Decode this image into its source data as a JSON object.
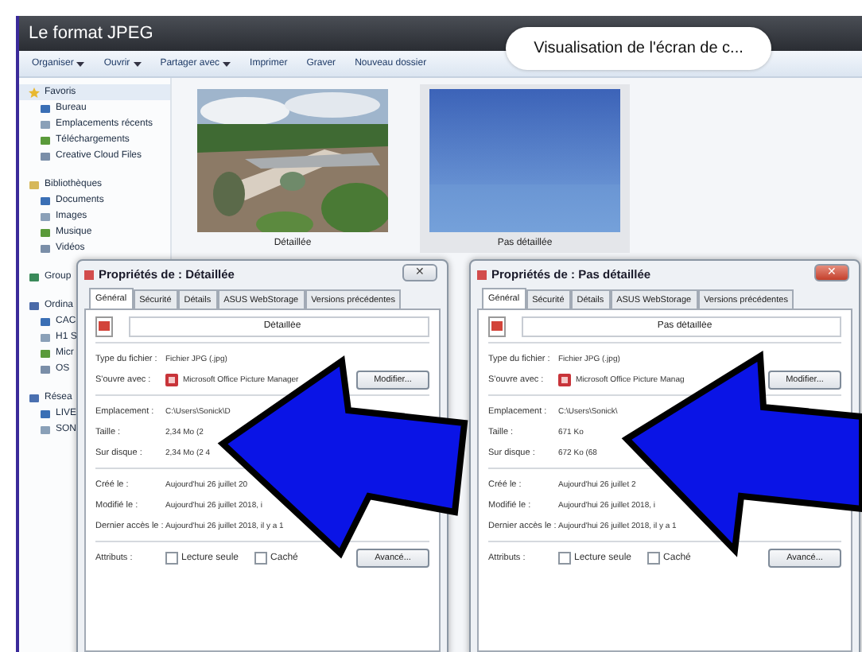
{
  "window": {
    "title": "Le format JPEG"
  },
  "caption": "Visualisation de l'écran de c...",
  "toolbar": [
    {
      "label": "Organiser",
      "dropdown": true
    },
    {
      "label": "Ouvrir",
      "dropdown": true
    },
    {
      "label": "Partager avec",
      "dropdown": true
    },
    {
      "label": "Imprimer",
      "dropdown": false
    },
    {
      "label": "Graver",
      "dropdown": false
    },
    {
      "label": "Nouveau dossier",
      "dropdown": false
    }
  ],
  "sidebar": [
    {
      "label": "Favoris",
      "selected": true,
      "children": [
        {
          "label": "Bureau"
        },
        {
          "label": "Emplacements récents"
        },
        {
          "label": "Téléchargements"
        },
        {
          "label": "Creative Cloud Files"
        }
      ]
    },
    {
      "label": "Bibliothèques",
      "selected": false,
      "children": [
        {
          "label": "Documents"
        },
        {
          "label": "Images"
        },
        {
          "label": "Musique"
        },
        {
          "label": "Vidéos"
        }
      ]
    },
    {
      "label": "Group",
      "selected": false
    },
    {
      "label": "Ordina",
      "selected": false,
      "children": [
        {
          "label": "CAC"
        },
        {
          "label": "H1 S"
        },
        {
          "label": "Micr"
        },
        {
          "label": "OS"
        }
      ]
    },
    {
      "label": "Résea",
      "selected": false,
      "children": [
        {
          "label": "LIVE"
        },
        {
          "label": "SON"
        }
      ]
    }
  ],
  "files": [
    {
      "name": "Détaillée",
      "selected": false
    },
    {
      "name": "Pas détaillée",
      "selected": true,
      "kind": "sky"
    }
  ],
  "dialogs": [
    {
      "title": "Propriétés de : Détaillée",
      "close_label": "✕",
      "close_highlighted": false,
      "tabs": [
        {
          "label": "Général",
          "selected": true
        },
        {
          "label": "Sécurité",
          "selected": false
        },
        {
          "label": "Détails",
          "selected": false
        },
        {
          "label": "ASUS WebStorage",
          "selected": false
        },
        {
          "label": "Versions précédentes",
          "selected": false
        }
      ],
      "name": "Détaillée",
      "sections": [
        [
          {
            "label": "Type du fichier :",
            "value": "Fichier JPG (.jpg)"
          },
          {
            "label": "S'ouvre avec :",
            "value": "Microsoft Office Picture Manager",
            "button": "Modifier..."
          }
        ],
        [
          {
            "label": "Emplacement :",
            "value": "C:\\Users\\Sonick\\D"
          },
          {
            "label": "Taille :",
            "value": "2,34 Mo (2"
          },
          {
            "label": "Sur disque :",
            "value": "2,34 Mo (2 4"
          }
        ],
        [
          {
            "label": "Créé le :",
            "value": "Aujourd'hui 26 juillet 20"
          },
          {
            "label": "Modifié le :",
            "value": "Aujourd'hui 26 juillet 2018, i"
          },
          {
            "label": "Dernier accès le :",
            "value": "Aujourd'hui 26 juillet 2018, il y a 1"
          }
        ]
      ],
      "attributes_label": "Attributs :",
      "attributes": [
        {
          "label": "Lecture seule",
          "checked": false
        },
        {
          "label": "Caché",
          "checked": false
        }
      ],
      "advanced_button": "Avancé..."
    },
    {
      "title": "Propriétés de : Pas détaillée",
      "close_label": "✕",
      "close_highlighted": true,
      "tabs": [
        {
          "label": "Général",
          "selected": true
        },
        {
          "label": "Sécurité",
          "selected": false
        },
        {
          "label": "Détails",
          "selected": false
        },
        {
          "label": "ASUS WebStorage",
          "selected": false
        },
        {
          "label": "Versions précédentes",
          "selected": false
        }
      ],
      "name": "Pas détaillée",
      "sections": [
        [
          {
            "label": "Type du fichier :",
            "value": "Fichier JPG (.jpg)"
          },
          {
            "label": "S'ouvre avec :",
            "value": "Microsoft Office Picture Manag",
            "button": "Modifier..."
          }
        ],
        [
          {
            "label": "Emplacement :",
            "value": "C:\\Users\\Sonick\\"
          },
          {
            "label": "Taille :",
            "value": "671 Ko"
          },
          {
            "label": "Sur disque :",
            "value": "672 Ko (68"
          }
        ],
        [
          {
            "label": "Créé le :",
            "value": "Aujourd'hui 26 juillet 2"
          },
          {
            "label": "Modifié le :",
            "value": "Aujourd'hui 26 juillet 2018, i"
          },
          {
            "label": "Dernier accès le :",
            "value": "Aujourd'hui 26 juillet 2018, il y a 1"
          }
        ]
      ],
      "attributes_label": "Attributs :",
      "attributes": [
        {
          "label": "Lecture seule",
          "checked": false
        },
        {
          "label": "Caché",
          "checked": false
        }
      ],
      "advanced_button": "Avancé..."
    }
  ]
}
